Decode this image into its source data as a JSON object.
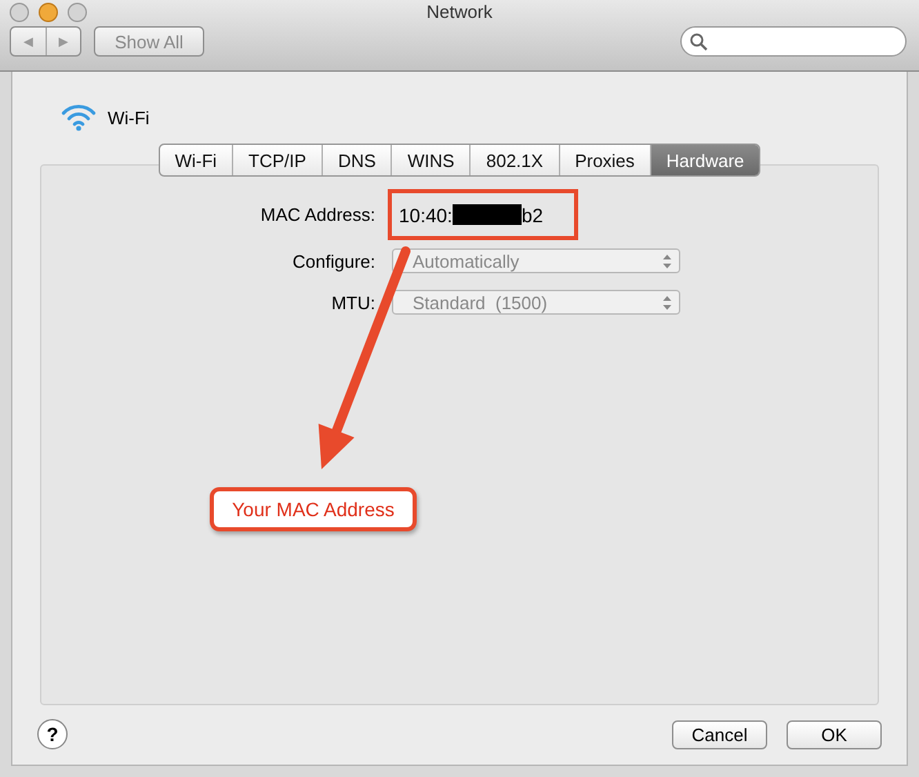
{
  "window": {
    "title": "Network"
  },
  "toolbar": {
    "show_all": "Show All",
    "back": "◀",
    "forward": "▶"
  },
  "service": {
    "name": "Wi-Fi"
  },
  "tabs": [
    {
      "label": "Wi-Fi",
      "selected": false
    },
    {
      "label": "TCP/IP",
      "selected": false
    },
    {
      "label": "DNS",
      "selected": false
    },
    {
      "label": "WINS",
      "selected": false
    },
    {
      "label": "802.1X",
      "selected": false
    },
    {
      "label": "Proxies",
      "selected": false
    },
    {
      "label": "Hardware",
      "selected": true
    }
  ],
  "fields": [
    {
      "kind": "text",
      "label": "MAC Address:",
      "value_start": "10:40:",
      "value_end": "b2",
      "redacted": true
    },
    {
      "kind": "popup",
      "label": "Configure:",
      "value": "Automatically"
    },
    {
      "kind": "popup",
      "label": "MTU:",
      "value": "Standard  (1500)"
    }
  ],
  "annotation": {
    "text": "Your MAC Address"
  },
  "buttons": [
    {
      "label": "Cancel"
    },
    {
      "label": "OK"
    }
  ],
  "help": {
    "label": "?"
  }
}
